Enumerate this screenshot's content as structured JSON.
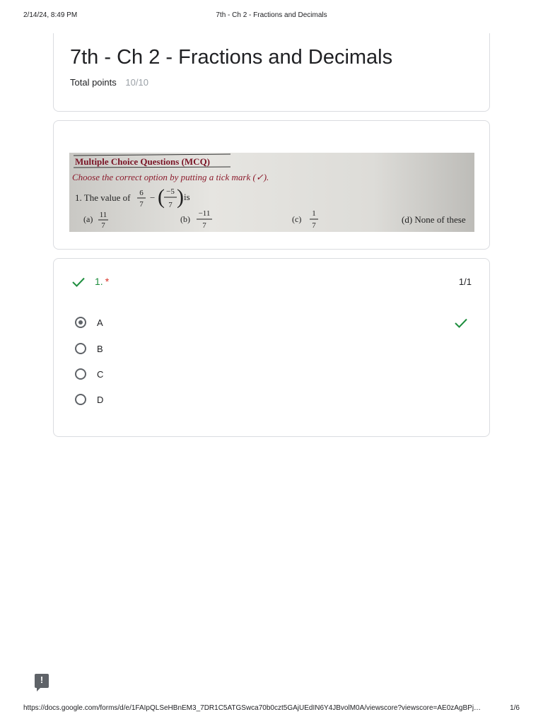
{
  "print_header": {
    "date": "2/14/24, 8:49 PM",
    "title": "7th - Ch 2 - Fractions and Decimals"
  },
  "form": {
    "title": "7th - Ch 2 - Fractions and Decimals",
    "points_label": "Total points",
    "points_value": "10/10"
  },
  "mcq_image": {
    "heading": "Multiple Choice Questions (MCQ)",
    "instruction": "Choose the correct option by putting a tick mark (✓).",
    "question_prefix": "1. The value of",
    "frac1_num": "6",
    "frac1_den": "7",
    "frac2_num": "−5",
    "frac2_den": "7",
    "question_suffix": "is",
    "opt_a_label": "(a)",
    "opt_a_num": "11",
    "opt_a_den": "7",
    "opt_b_label": "(b)",
    "opt_b_num": "−11",
    "opt_b_den": "7",
    "opt_c_label": "(c)",
    "opt_c_num": "1",
    "opt_c_den": "7",
    "opt_d_text": "(d) None of these"
  },
  "question": {
    "number": "1.",
    "required_mark": "*",
    "score": "1/1",
    "options": [
      "A",
      "B",
      "C",
      "D"
    ],
    "selected": "A"
  },
  "colors": {
    "correct": "#1e8e3e",
    "required": "#d93025",
    "border": "#dadce0",
    "image_heading": "#7a1426"
  },
  "icons": {
    "question_status": "check-icon",
    "option_correct": "check-icon",
    "feedback": "feedback-icon"
  },
  "print_footer": {
    "url": "https://docs.google.com/forms/d/e/1FAIpQLSeHBnEM3_7DR1C5ATGSwca70b0czt5GAjUEdIN6Y4JBvolM0A/viewscore?viewscore=AE0zAgBPj…",
    "page": "1/6"
  }
}
